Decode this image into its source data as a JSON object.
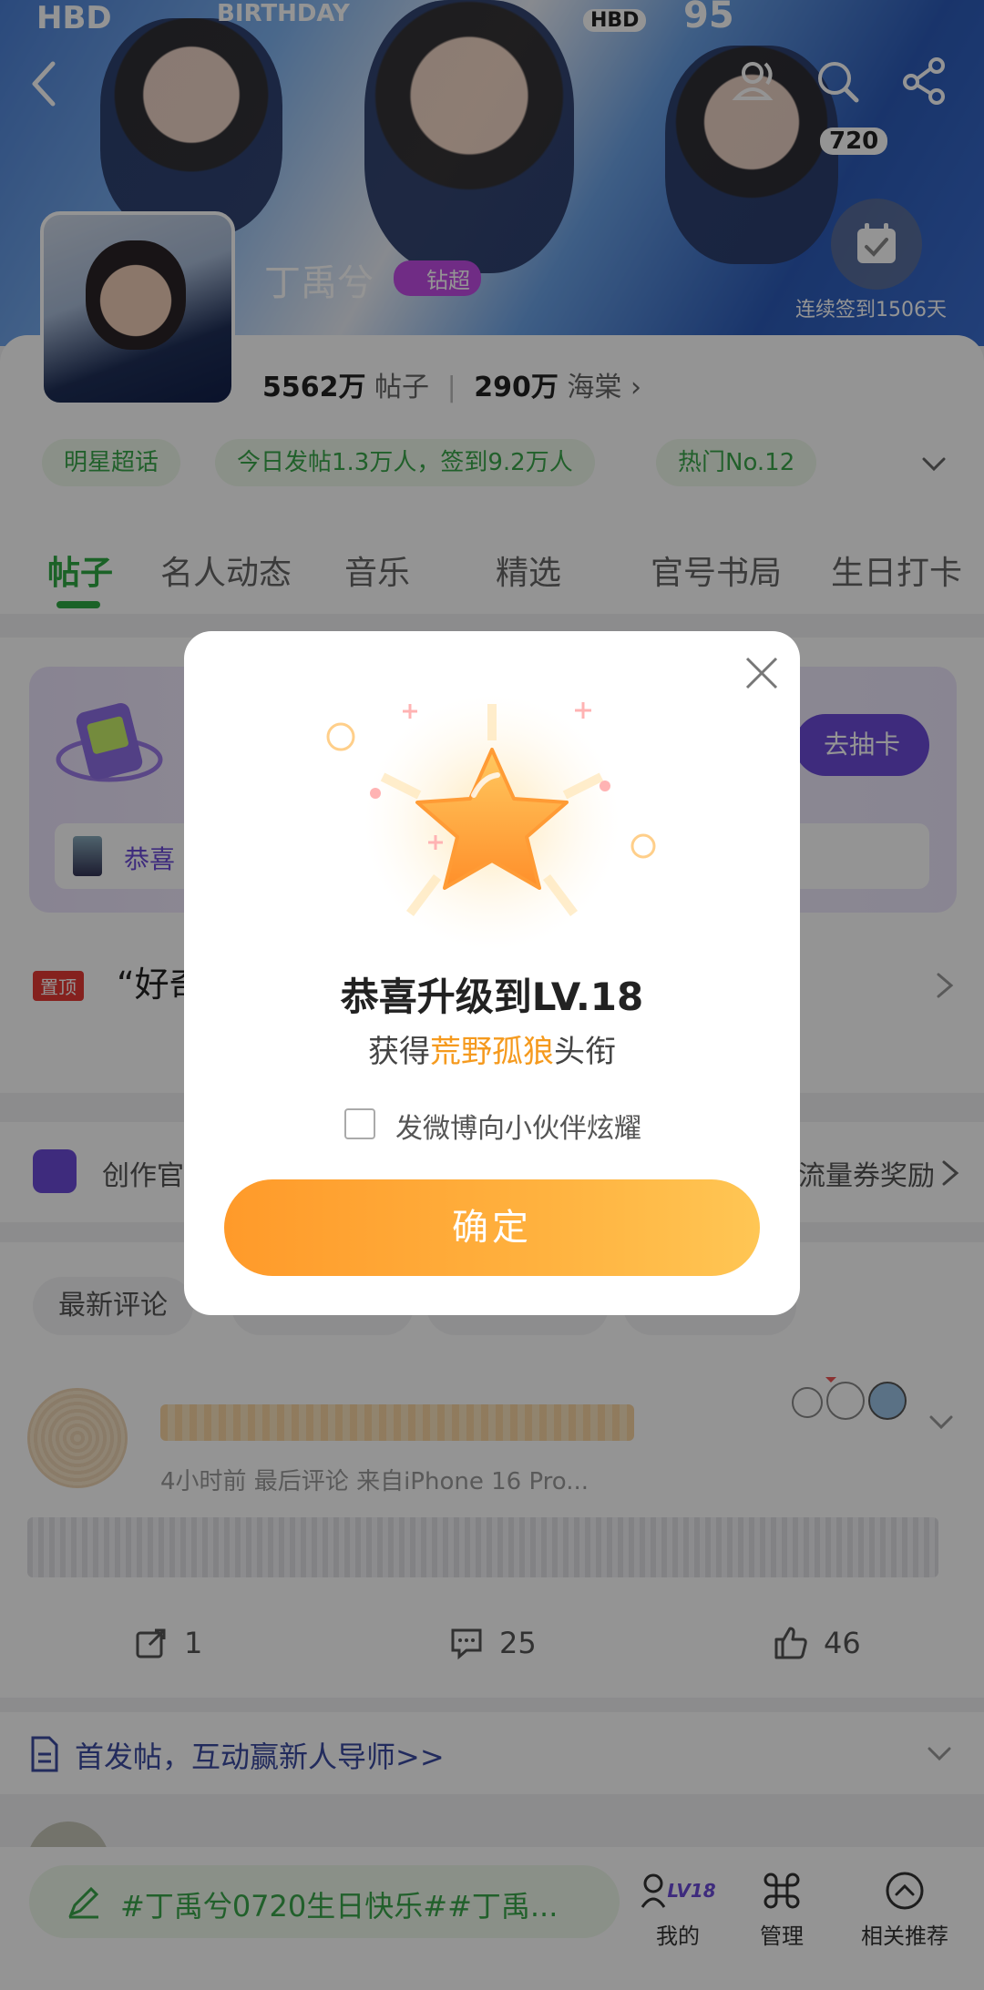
{
  "banner": {
    "name": "丁禹兮",
    "vip_label": "钻超",
    "checkin_text": "连续签到1506天",
    "tags": [
      "HBD",
      "BIRTHDAY",
      "HBD",
      "95",
      "720"
    ]
  },
  "stats": {
    "posts_count": "5562万",
    "posts_label": "帖子",
    "fans_count": "290万",
    "fans_label": "海棠"
  },
  "chips": [
    "明星超话",
    "今日发帖1.3万人，签到9.2万人",
    "热门No.12"
  ],
  "tabs": [
    "帖子",
    "名人动态",
    "音乐",
    "精选",
    "官号书局",
    "生日打卡"
  ],
  "card_section": {
    "draw_button": "去抽卡",
    "row_text": "恭喜"
  },
  "pinned": {
    "badge": "置顶",
    "text": "“好奇"
  },
  "creator": {
    "left_text": "创作官",
    "right_text": "流量券奖励"
  },
  "sort_chips": [
    "最新评论",
    "",
    "",
    ""
  ],
  "post": {
    "meta": "4小时前 最后评论 来自iPhone 16 Pro...",
    "repost_count": "1",
    "comment_count": "25",
    "like_count": "46"
  },
  "first_post_banner": "首发帖，互动赢新人导师>>",
  "bottom": {
    "compose_text": "#丁禹兮0720生日快乐##丁禹...",
    "nav": [
      {
        "label": "我的",
        "badge": "LV18"
      },
      {
        "label": "管理"
      },
      {
        "label": "相关推荐"
      }
    ]
  },
  "modal": {
    "title": "恭喜升级到LV.18",
    "subtitle_prefix": "获得",
    "subtitle_highlight": "荒野孤狼",
    "subtitle_suffix": "头衔",
    "share_label": "发微博向小伙伴炫耀",
    "confirm_label": "确定"
  },
  "colors": {
    "accent_green": "#2faa44",
    "accent_purple": "#6b4bd8",
    "accent_orange": "#ffa733"
  }
}
